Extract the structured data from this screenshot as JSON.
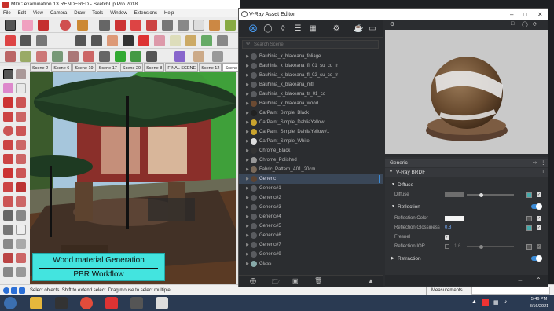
{
  "sketchup": {
    "title": "MDC examination 13 RENDERED - SketchUp Pro 2018",
    "menu": [
      "File",
      "Edit",
      "View",
      "Camera",
      "Draw",
      "Tools",
      "Window",
      "Extensions",
      "Help"
    ],
    "scenes": [
      "Scene 2",
      "Scene 6",
      "Scene 19",
      "Scene 17",
      "Scene 20",
      "Scene 8",
      "FINAL SCENE",
      "Scene 12",
      "Scene"
    ],
    "caption": {
      "line1": "Wood material Generation",
      "line2": "PBR Workflow"
    },
    "status": "Select objects. Shift to extend select. Drag mouse to select multiple.",
    "measurements_label": "Measurements"
  },
  "vray": {
    "title": "V-Ray Asset Editor",
    "search_placeholder": "Search Scene",
    "materials": [
      "Bauhinia_x_blakeana_foliage",
      "Bauhinia_x_blakeana_fl_01_su_co_fr",
      "Bauhinia_x_blakeana_fl_02_su_co_fr",
      "Bauhinia_x_blakeana_mtl",
      "Bauhinia_x_blakeana_tr_01_co",
      "Bauhinia_x_blakeana_wood",
      "CarPaint_Simple_Black",
      "CarPaint_Simple_DahliaYellow",
      "CarPaint_Simple_DahliaYellow#1",
      "CarPaint_Simple_White",
      "Chrome_Black",
      "Chrome_Polished",
      "Fabric_Pattern_A01_20cm",
      "Generic",
      "Generic#1",
      "Generic#2",
      "Generic#3",
      "Generic#4",
      "Generic#5",
      "Generic#6",
      "Generic#7",
      "Generic#9",
      "Glass"
    ],
    "selected": "Generic",
    "props": {
      "material_name": "Generic",
      "layer": "V-Ray BRDF",
      "diffuse_section": "Diffuse",
      "diffuse_label": "Diffuse",
      "reflection_section": "Reflection",
      "reflection_color_label": "Reflection Color",
      "reflection_gloss_label": "Reflection Glossiness",
      "reflection_gloss_value": "0.8",
      "fresnel_label": "Fresnel",
      "reflection_ior_label": "Reflection IOR",
      "reflection_ior_value": "1.6",
      "refraction_section": "Refraction"
    }
  },
  "taskbar": {
    "time": "5:46 PM",
    "date": "8/16/2021"
  }
}
